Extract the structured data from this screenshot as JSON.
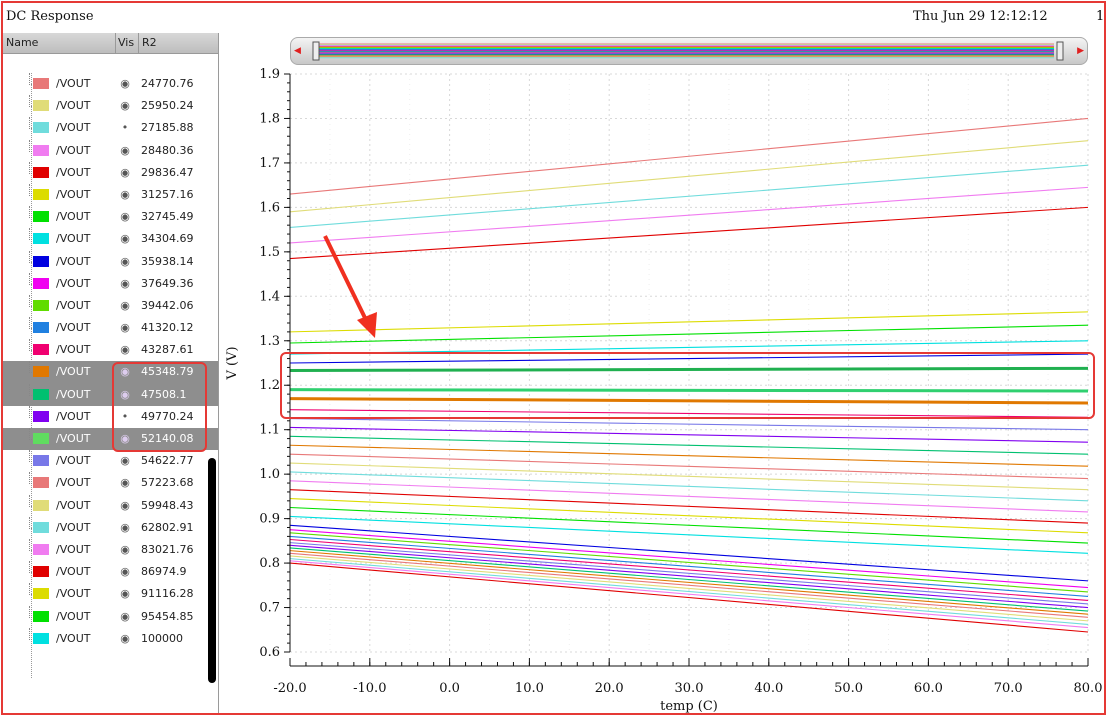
{
  "window": {
    "title": "DC Response",
    "date": "Thu Jun 29 12:12:12",
    "page": "1"
  },
  "panel": {
    "headers": {
      "name": "Name",
      "vis": "Vis",
      "r2": "R2"
    },
    "rows": [
      {
        "name": "/VOUT",
        "color": "#e87878",
        "vis": "eye",
        "r2": "24770.76",
        "selected": false
      },
      {
        "name": "/VOUT",
        "color": "#e0dc78",
        "vis": "eye",
        "r2": "25950.24",
        "selected": false
      },
      {
        "name": "/VOUT",
        "color": "#70dcdc",
        "vis": "dot",
        "r2": "27185.88",
        "selected": false
      },
      {
        "name": "/VOUT",
        "color": "#f07cf0",
        "vis": "eye",
        "r2": "28480.36",
        "selected": false
      },
      {
        "name": "/VOUT",
        "color": "#e00000",
        "vis": "eye",
        "r2": "29836.47",
        "selected": false
      },
      {
        "name": "/VOUT",
        "color": "#dcdc00",
        "vis": "eye",
        "r2": "31257.16",
        "selected": false
      },
      {
        "name": "/VOUT",
        "color": "#00e000",
        "vis": "eye",
        "r2": "32745.49",
        "selected": false
      },
      {
        "name": "/VOUT",
        "color": "#00e0e0",
        "vis": "eye",
        "r2": "34304.69",
        "selected": false
      },
      {
        "name": "/VOUT",
        "color": "#0000e0",
        "vis": "eye",
        "r2": "35938.14",
        "selected": false
      },
      {
        "name": "/VOUT",
        "color": "#f000f0",
        "vis": "eye",
        "r2": "37649.36",
        "selected": false
      },
      {
        "name": "/VOUT",
        "color": "#60dc00",
        "vis": "eye",
        "r2": "39442.06",
        "selected": false
      },
      {
        "name": "/VOUT",
        "color": "#2080e0",
        "vis": "eye",
        "r2": "41320.12",
        "selected": false
      },
      {
        "name": "/VOUT",
        "color": "#f00070",
        "vis": "eye",
        "r2": "43287.61",
        "selected": false
      },
      {
        "name": "/VOUT",
        "color": "#e07800",
        "vis": "eye",
        "r2": "45348.79",
        "selected": true
      },
      {
        "name": "/VOUT",
        "color": "#00c070",
        "vis": "eye",
        "r2": "47508.1",
        "selected": true
      },
      {
        "name": "/VOUT",
        "color": "#8000f0",
        "vis": "dot",
        "r2": "49770.24",
        "selected": false
      },
      {
        "name": "/VOUT",
        "color": "#60dc60",
        "vis": "eye",
        "r2": "52140.08",
        "selected": true
      },
      {
        "name": "/VOUT",
        "color": "#7878e8",
        "vis": "eye",
        "r2": "54622.77",
        "selected": false
      },
      {
        "name": "/VOUT",
        "color": "#e87878",
        "vis": "eye",
        "r2": "57223.68",
        "selected": false
      },
      {
        "name": "/VOUT",
        "color": "#e0dc78",
        "vis": "eye",
        "r2": "59948.43",
        "selected": false
      },
      {
        "name": "/VOUT",
        "color": "#70dcdc",
        "vis": "eye",
        "r2": "62802.91",
        "selected": false
      },
      {
        "name": "/VOUT",
        "color": "#f07cf0",
        "vis": "eye",
        "r2": "83021.76",
        "selected": false
      },
      {
        "name": "/VOUT",
        "color": "#e00000",
        "vis": "eye",
        "r2": "86974.9",
        "selected": false
      },
      {
        "name": "/VOUT",
        "color": "#dcdc00",
        "vis": "eye",
        "r2": "91116.28",
        "selected": false
      },
      {
        "name": "/VOUT",
        "color": "#00e000",
        "vis": "eye",
        "r2": "95454.85",
        "selected": false
      },
      {
        "name": "/VOUT",
        "color": "#00e0e0",
        "vis": "eye",
        "r2": "100000",
        "selected": false
      }
    ]
  },
  "chart_data": {
    "type": "line",
    "xlabel": "temp (C)",
    "ylabel": "V (V)",
    "xlim": [
      -20,
      80
    ],
    "ylim": [
      0.6,
      1.9
    ],
    "xticks": [
      -20,
      -10,
      0,
      10,
      20,
      30,
      40,
      50,
      60,
      70,
      80
    ],
    "xtick_labels": [
      "-20.0",
      "-10.0",
      "0.0",
      "10.0",
      "20.0",
      "30.0",
      "40.0",
      "50.0",
      "60.0",
      "70.0",
      "80.0"
    ],
    "yticks": [
      0.6,
      0.7,
      0.8,
      0.9,
      1.0,
      1.1,
      1.2,
      1.3,
      1.4,
      1.5,
      1.6,
      1.7,
      1.8,
      1.9
    ],
    "ytick_labels": [
      "0.6",
      "0.7",
      "0.8",
      "0.9",
      "1.0",
      "1.1",
      "1.2",
      "1.3",
      "1.4",
      "1.5",
      "1.6",
      "1.7",
      "1.8",
      "1.9"
    ],
    "grid": true,
    "series_colors": [
      "#e87878",
      "#e0dc78",
      "#70dcdc",
      "#f07cf0",
      "#e00000",
      "#dcdc00",
      "#00e000",
      "#00e0e0",
      "#0000e0",
      "#f000f0",
      "#60dc00",
      "#2080e0",
      "#f00070",
      "#7878e8",
      "#8000f0",
      "#00c070",
      "#e07800"
    ],
    "series": [
      {
        "x": [
          -20,
          80
        ],
        "y": [
          1.63,
          1.8
        ]
      },
      {
        "x": [
          -20,
          80
        ],
        "y": [
          1.59,
          1.75
        ]
      },
      {
        "x": [
          -20,
          80
        ],
        "y": [
          1.555,
          1.695
        ]
      },
      {
        "x": [
          -20,
          80
        ],
        "y": [
          1.52,
          1.645
        ]
      },
      {
        "x": [
          -20,
          80
        ],
        "y": [
          1.485,
          1.6
        ]
      },
      {
        "x": [
          -20,
          80
        ],
        "y": [
          1.32,
          1.365
        ]
      },
      {
        "x": [
          -20,
          80
        ],
        "y": [
          1.295,
          1.335
        ]
      },
      {
        "x": [
          -20,
          80
        ],
        "y": [
          1.27,
          1.3
        ]
      },
      {
        "x": [
          -20,
          80
        ],
        "y": [
          1.25,
          1.27
        ]
      },
      {
        "x": [
          -20,
          80
        ],
        "y": [
          1.233,
          1.238
        ],
        "bold": true,
        "color": "#20b050"
      },
      {
        "x": [
          -20,
          80
        ],
        "y": [
          1.19,
          1.187
        ],
        "bold": true,
        "color": "#30d070"
      },
      {
        "x": [
          -20,
          80
        ],
        "y": [
          1.17,
          1.16
        ],
        "bold": true,
        "color": "#e07800"
      },
      {
        "x": [
          -20,
          80
        ],
        "y": [
          1.145,
          1.128
        ]
      },
      {
        "x": [
          -20,
          80
        ],
        "y": [
          1.125,
          1.1
        ]
      },
      {
        "x": [
          -20,
          80
        ],
        "y": [
          1.105,
          1.072
        ]
      },
      {
        "x": [
          -20,
          80
        ],
        "y": [
          1.085,
          1.045
        ]
      },
      {
        "x": [
          -20,
          80
        ],
        "y": [
          1.065,
          1.018
        ]
      },
      {
        "x": [
          -20,
          80
        ],
        "y": [
          1.045,
          0.99
        ]
      },
      {
        "x": [
          -20,
          80
        ],
        "y": [
          1.025,
          0.965
        ]
      },
      {
        "x": [
          -20,
          80
        ],
        "y": [
          1.005,
          0.94
        ]
      },
      {
        "x": [
          -20,
          80
        ],
        "y": [
          0.985,
          0.915
        ]
      },
      {
        "x": [
          -20,
          80
        ],
        "y": [
          0.965,
          0.89
        ]
      },
      {
        "x": [
          -20,
          80
        ],
        "y": [
          0.945,
          0.868
        ]
      },
      {
        "x": [
          -20,
          80
        ],
        "y": [
          0.925,
          0.845
        ]
      },
      {
        "x": [
          -20,
          80
        ],
        "y": [
          0.905,
          0.822
        ]
      },
      {
        "x": [
          -20,
          80
        ],
        "y": [
          0.885,
          0.76
        ]
      },
      {
        "x": [
          -20,
          80
        ],
        "y": [
          0.875,
          0.745
        ]
      },
      {
        "x": [
          -20,
          80
        ],
        "y": [
          0.868,
          0.735
        ]
      },
      {
        "x": [
          -20,
          80
        ],
        "y": [
          0.86,
          0.725
        ]
      },
      {
        "x": [
          -20,
          80
        ],
        "y": [
          0.853,
          0.716
        ]
      },
      {
        "x": [
          -20,
          80
        ],
        "y": [
          0.846,
          0.708
        ]
      },
      {
        "x": [
          -20,
          80
        ],
        "y": [
          0.84,
          0.7
        ]
      },
      {
        "x": [
          -20,
          80
        ],
        "y": [
          0.834,
          0.692
        ]
      },
      {
        "x": [
          -20,
          80
        ],
        "y": [
          0.828,
          0.685
        ]
      },
      {
        "x": [
          -20,
          80
        ],
        "y": [
          0.822,
          0.678
        ]
      },
      {
        "x": [
          -20,
          80
        ],
        "y": [
          0.816,
          0.67
        ]
      },
      {
        "x": [
          -20,
          80
        ],
        "y": [
          0.81,
          0.662
        ]
      },
      {
        "x": [
          -20,
          80
        ],
        "y": [
          0.805,
          0.655
        ]
      },
      {
        "x": [
          -20,
          80
        ],
        "y": [
          0.8,
          0.645
        ]
      }
    ]
  }
}
